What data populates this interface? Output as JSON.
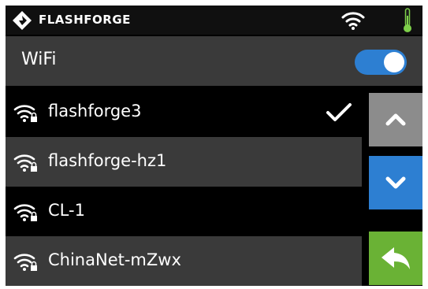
{
  "topbar": {
    "brand": "FLASHFORGE",
    "icons": [
      "logo-icon",
      "wifi-icon",
      "thermometer-icon"
    ]
  },
  "wifi": {
    "title": "WiFi",
    "enabled": true
  },
  "networks": [
    {
      "ssid": "flashforge3",
      "connected": true,
      "locked": true
    },
    {
      "ssid": "flashforge-hz1",
      "connected": false,
      "locked": true
    },
    {
      "ssid": "CL-1",
      "connected": false,
      "locked": true
    },
    {
      "ssid": "ChinaNet-mZwx",
      "connected": false,
      "locked": true
    }
  ],
  "buttons": {
    "up_icon": "chevron-up-icon",
    "down_icon": "chevron-down-icon",
    "back_icon": "back-arrow-icon"
  },
  "colors": {
    "accent_blue": "#2d7fd2",
    "back_green": "#6ab235",
    "up_gray": "#8c8c8c",
    "row_alt": "#3a3a3a"
  }
}
